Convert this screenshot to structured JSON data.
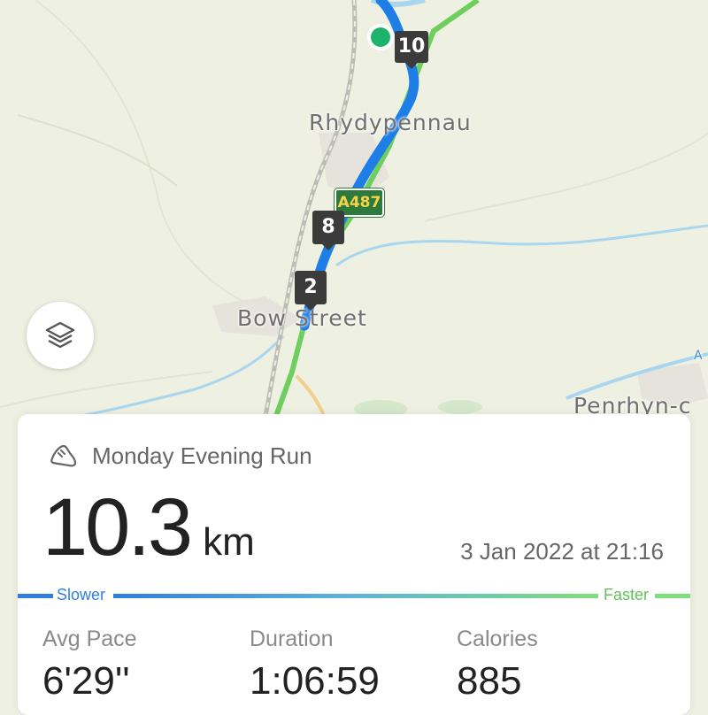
{
  "map": {
    "places": [
      "Rhydypennau",
      "Bow Street",
      "Penrhyn-c",
      "A"
    ],
    "road_shield": "A487",
    "km_markers": [
      "10",
      "8",
      "2"
    ],
    "layers_button": "layers-icon"
  },
  "activity": {
    "icon": "running-shoe-icon",
    "title": "Monday Evening Run",
    "distance_value": "10.3",
    "distance_unit": "km",
    "date": "3 Jan 2022 at 21:16"
  },
  "pace_legend": {
    "slower_label": "Slower",
    "faster_label": "Faster",
    "slow_color": "#2f7fe0",
    "fast_color": "#7ee07a"
  },
  "stats": [
    {
      "label": "Avg Pace",
      "value": "6'29''"
    },
    {
      "label": "Duration",
      "value": "1:06:59"
    },
    {
      "label": "Calories",
      "value": "885"
    }
  ]
}
